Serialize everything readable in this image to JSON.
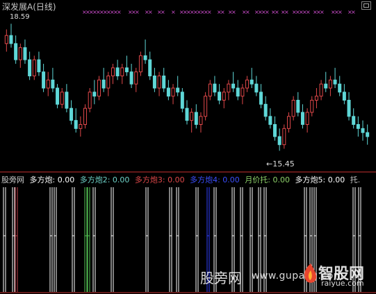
{
  "main_header": {
    "title": "深发展A",
    "period": "(日线)"
  },
  "price_labels": {
    "high": "18.59",
    "low": "←15.45"
  },
  "indicator_header": {
    "name": "股旁网",
    "items": [
      {
        "label": "多方炮: 0.00",
        "color": "#ffffff"
      },
      {
        "label": "多方炮2: 0.00",
        "color": "#6fd3c9"
      },
      {
        "label": "多方炮3: 0.00",
        "color": "#e0484a"
      },
      {
        "label": "多方炮4: 0.00",
        "color": "#3b4fff"
      },
      {
        "label": "月价托: 0.00",
        "color": "#8fd36b"
      },
      {
        "label": "多方炮5: 0.00",
        "color": "#ffffff"
      },
      {
        "label": "托.",
        "color": "#c8c8c8"
      }
    ]
  },
  "watermark": {
    "left_text": "股旁网",
    "url": "www.gupang.com",
    "brand": "智股网",
    "brand_url": "raiyue.com"
  },
  "colors": {
    "up": "#e0484a",
    "down": "#5fd7d7",
    "signal_white": "#ffffff",
    "signal_green": "#55c455",
    "signal_blue": "#2f3fff",
    "signal_red": "#c0404a",
    "marker": "#d14fd1",
    "divider": "#c83232"
  },
  "chart_data": {
    "type": "candlestick",
    "title": "深发展A (日线)",
    "price_range": [
      15.2,
      18.8
    ],
    "annotated_high": 18.59,
    "annotated_low": 15.45,
    "candles": [
      [
        18.1,
        18.45,
        17.9,
        18.3
      ],
      [
        18.3,
        18.59,
        18.0,
        18.1
      ],
      [
        18.1,
        18.3,
        17.6,
        17.7
      ],
      [
        17.7,
        18.1,
        17.5,
        18.0
      ],
      [
        18.0,
        18.2,
        17.6,
        17.7
      ],
      [
        17.7,
        17.9,
        17.2,
        17.3
      ],
      [
        17.3,
        17.8,
        17.2,
        17.7
      ],
      [
        17.7,
        17.9,
        17.3,
        17.4
      ],
      [
        17.4,
        17.6,
        16.9,
        17.0
      ],
      [
        17.0,
        17.4,
        16.8,
        17.2
      ],
      [
        17.2,
        17.5,
        16.9,
        17.0
      ],
      [
        17.0,
        17.1,
        16.5,
        16.6
      ],
      [
        16.6,
        17.0,
        16.5,
        16.9
      ],
      [
        16.9,
        17.1,
        16.4,
        16.5
      ],
      [
        16.5,
        16.7,
        16.1,
        16.2
      ],
      [
        16.2,
        16.5,
        15.9,
        16.0
      ],
      [
        16.0,
        16.3,
        15.8,
        16.1
      ],
      [
        16.1,
        16.6,
        16.0,
        16.5
      ],
      [
        16.5,
        17.0,
        16.4,
        16.9
      ],
      [
        16.9,
        17.2,
        16.6,
        16.8
      ],
      [
        16.8,
        17.3,
        16.7,
        17.2
      ],
      [
        17.2,
        17.5,
        16.9,
        17.0
      ],
      [
        17.0,
        17.4,
        16.8,
        17.3
      ],
      [
        17.3,
        17.6,
        17.1,
        17.5
      ],
      [
        17.5,
        17.7,
        17.2,
        17.3
      ],
      [
        17.3,
        17.6,
        17.1,
        17.5
      ],
      [
        17.5,
        17.8,
        17.3,
        17.4
      ],
      [
        17.4,
        17.6,
        17.0,
        17.1
      ],
      [
        17.1,
        17.5,
        16.9,
        17.4
      ],
      [
        17.4,
        17.9,
        17.3,
        17.8
      ],
      [
        17.8,
        18.2,
        17.6,
        17.7
      ],
      [
        17.7,
        17.9,
        17.2,
        17.3
      ],
      [
        17.3,
        17.5,
        16.9,
        17.0
      ],
      [
        17.0,
        17.4,
        16.8,
        17.3
      ],
      [
        17.3,
        17.5,
        16.9,
        17.0
      ],
      [
        17.0,
        17.2,
        16.7,
        16.8
      ],
      [
        16.8,
        17.1,
        16.6,
        17.0
      ],
      [
        17.0,
        17.3,
        16.8,
        16.9
      ],
      [
        16.9,
        17.0,
        16.4,
        16.5
      ],
      [
        16.5,
        16.7,
        16.1,
        16.2
      ],
      [
        16.2,
        16.5,
        15.9,
        16.4
      ],
      [
        16.4,
        16.6,
        16.0,
        16.1
      ],
      [
        16.1,
        16.4,
        15.9,
        16.3
      ],
      [
        16.3,
        16.9,
        16.2,
        16.8
      ],
      [
        16.8,
        17.2,
        16.7,
        17.1
      ],
      [
        17.1,
        17.3,
        16.8,
        16.9
      ],
      [
        16.9,
        17.1,
        16.6,
        16.7
      ],
      [
        16.7,
        17.0,
        16.5,
        16.9
      ],
      [
        16.9,
        17.2,
        16.7,
        17.1
      ],
      [
        17.1,
        17.4,
        16.9,
        17.0
      ],
      [
        17.0,
        17.2,
        16.7,
        16.8
      ],
      [
        16.8,
        17.1,
        16.6,
        17.0
      ],
      [
        17.0,
        17.3,
        16.9,
        17.2
      ],
      [
        17.2,
        17.5,
        17.0,
        17.1
      ],
      [
        17.1,
        17.3,
        16.8,
        16.9
      ],
      [
        16.9,
        17.1,
        16.5,
        16.6
      ],
      [
        16.6,
        16.8,
        16.2,
        16.3
      ],
      [
        16.3,
        16.5,
        16.0,
        16.1
      ],
      [
        16.1,
        16.3,
        15.7,
        15.8
      ],
      [
        15.8,
        16.0,
        15.45,
        15.6
      ],
      [
        15.6,
        16.1,
        15.5,
        16.0
      ],
      [
        16.0,
        16.4,
        15.9,
        16.3
      ],
      [
        16.3,
        16.8,
        16.2,
        16.7
      ],
      [
        16.7,
        16.9,
        16.3,
        16.4
      ],
      [
        16.4,
        16.6,
        16.0,
        16.1
      ],
      [
        16.1,
        16.5,
        15.9,
        16.4
      ],
      [
        16.4,
        16.8,
        16.3,
        16.7
      ],
      [
        16.7,
        17.0,
        16.5,
        16.8
      ],
      [
        16.8,
        17.2,
        16.7,
        17.1
      ],
      [
        17.1,
        17.4,
        16.9,
        17.0
      ],
      [
        17.0,
        17.3,
        16.8,
        17.2
      ],
      [
        17.2,
        17.5,
        17.0,
        17.1
      ],
      [
        17.1,
        17.3,
        16.8,
        16.9
      ],
      [
        16.9,
        17.1,
        16.6,
        16.7
      ],
      [
        16.7,
        16.9,
        16.2,
        16.3
      ],
      [
        16.3,
        16.5,
        16.0,
        16.1
      ],
      [
        16.1,
        16.3,
        15.8,
        16.0
      ],
      [
        16.0,
        16.2,
        15.7,
        15.9
      ],
      [
        15.9,
        16.1,
        15.6,
        15.8
      ]
    ]
  }
}
